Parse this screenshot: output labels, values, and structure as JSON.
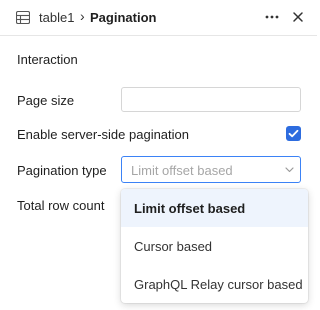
{
  "header": {
    "parent_label": "table1",
    "separator": "›",
    "current_label": "Pagination",
    "icons": {
      "table": "table-icon",
      "more": "more-horizontal-icon",
      "close": "close-icon"
    }
  },
  "section": {
    "title": "Interaction"
  },
  "fields": {
    "page_size": {
      "label": "Page size",
      "value": "",
      "placeholder": ""
    },
    "server_side": {
      "label": "Enable server-side pagination",
      "checked": true
    },
    "pagination_type": {
      "label": "Pagination type",
      "selected": "Limit offset based"
    },
    "total_row_count": {
      "label": "Total row count"
    }
  },
  "dropdown": {
    "options": [
      {
        "label": "Limit offset based",
        "selected": true
      },
      {
        "label": "Cursor based",
        "selected": false
      },
      {
        "label": "GraphQL Relay cursor based",
        "selected": false
      }
    ]
  },
  "colors": {
    "accent": "#2d6cdf",
    "focus_border": "#3b82f6",
    "selected_bg": "#eef4fd"
  }
}
